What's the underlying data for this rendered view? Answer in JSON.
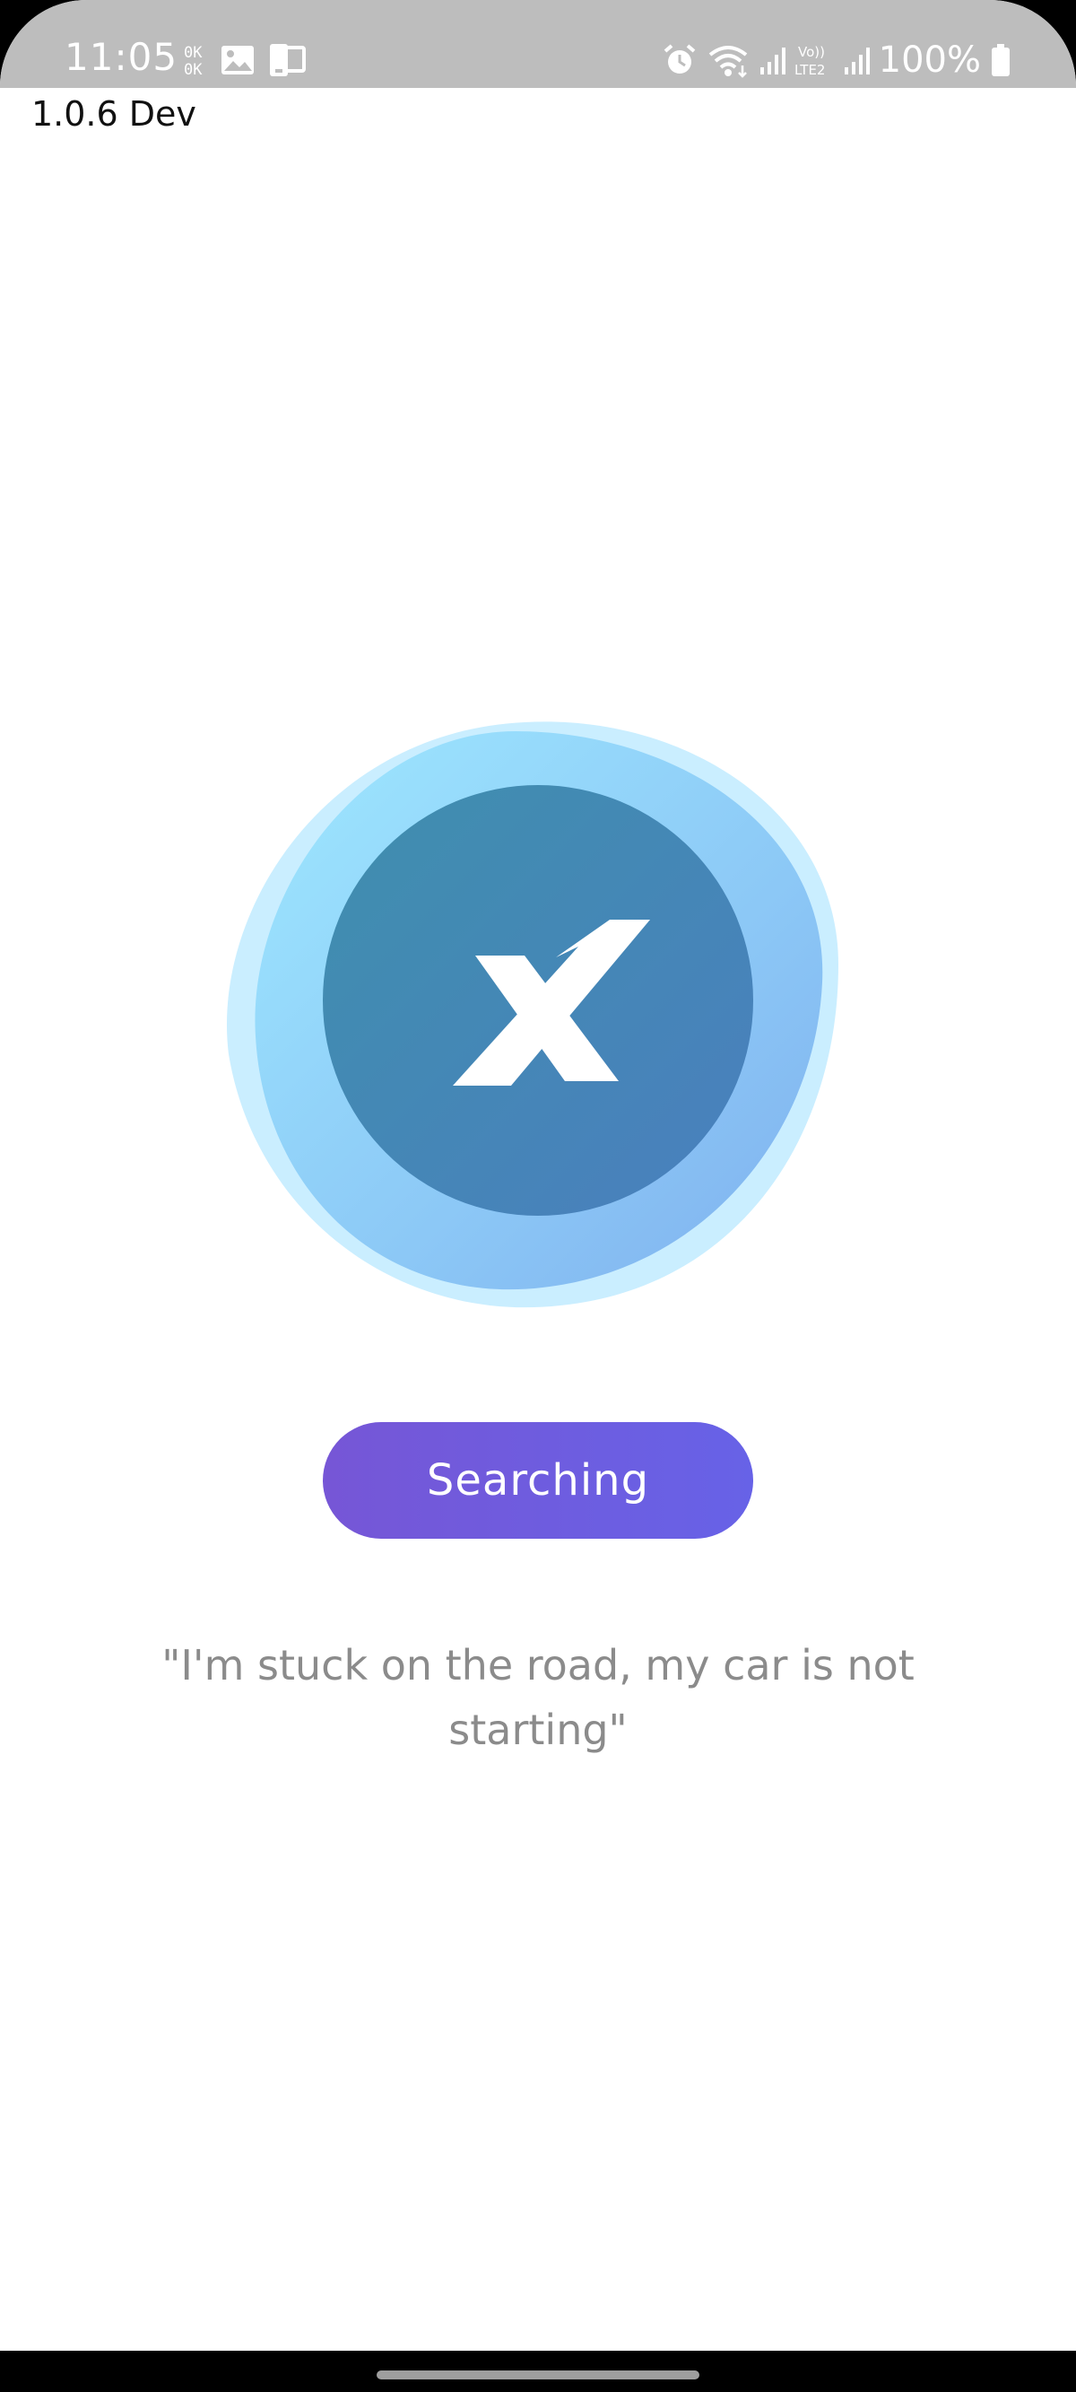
{
  "status_bar": {
    "time": "11:05",
    "battery": "100%",
    "left_icons": [
      "ok-icon",
      "image-icon",
      "phone-share-icon"
    ],
    "right_icons": [
      "alarm-icon",
      "wifi-icon",
      "signal-icon",
      "volte-lte2-icon",
      "signal-2-icon",
      "battery-icon"
    ]
  },
  "app": {
    "version": "1.0.6 Dev",
    "logo_icon": "brand-x-logo-icon",
    "search_button_label": "Searching",
    "quote": "\"I'm stuck on the road, my car is not starting\""
  },
  "colors": {
    "status_bar_bg": "#bdbdbd",
    "button_start": "#7656d6",
    "button_end": "#6762e7",
    "blob_light": "#9ee8ff",
    "logo_circle": "#438ab3",
    "quote_text": "#8b8b8b"
  }
}
